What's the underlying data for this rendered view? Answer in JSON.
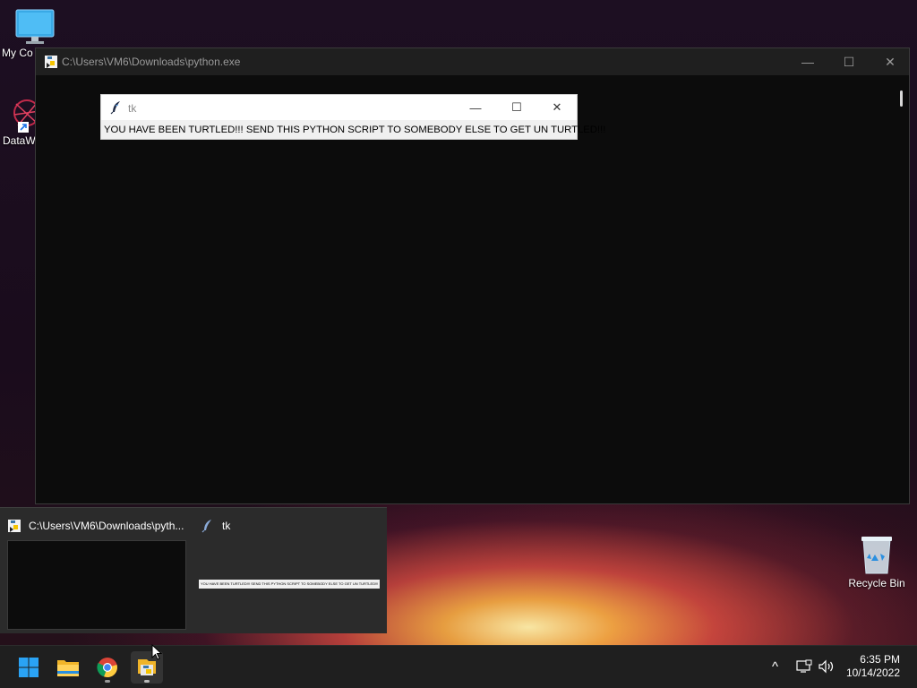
{
  "desktop": {
    "icons": [
      {
        "label": "My Co"
      },
      {
        "label": "DataW"
      },
      {
        "label": "Recycle Bin"
      }
    ]
  },
  "console": {
    "title": "C:\\Users\\VM6\\Downloads\\python.exe",
    "minimize": "—",
    "maximize": "☐",
    "close": "✕"
  },
  "tk_window": {
    "title": "tk",
    "minimize": "—",
    "maximize": "☐",
    "close": "✕",
    "message": "YOU HAVE BEEN TURTLED!!! SEND THIS PYTHON SCRIPT TO SOMEBODY ELSE TO GET UN TURTLED!!!"
  },
  "taskbar_preview": {
    "items": [
      {
        "title": "C:\\Users\\VM6\\Downloads\\pyth..."
      },
      {
        "title": "tk",
        "thumb_text": "YOU HAVE BEEN TURTLED!!! SEND THIS PYTHON SCRIPT TO SOMEBODY ELSE TO GET UN TURTLED!!!"
      }
    ]
  },
  "taskbar": {
    "apps": [
      "start-icon",
      "file-explorer-icon",
      "chrome-icon",
      "python-icon"
    ],
    "tray_chevron": "^",
    "clock_time": "6:35 PM",
    "clock_date": "10/14/2022"
  },
  "colors": {
    "console_bg": "#0c0c0c",
    "titlebar_dark": "#1f1f1f",
    "taskbar_bg": "#1f1f1f",
    "accent_blue": "#3aa0ff"
  }
}
